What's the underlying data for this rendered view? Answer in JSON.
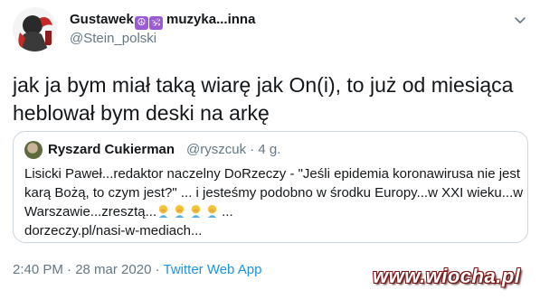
{
  "author": {
    "name": "Gustawek",
    "emoji_1": "☮",
    "emoji_2": "🕉",
    "name_suffix": " muzyka...inna",
    "handle": "@Stein_polski"
  },
  "tweet": {
    "line_1": "jak ja bym miał taką wiarę jak On(i), to już od miesiąca",
    "line_2": "heblował bym deski na arkę"
  },
  "quoted_tweet": {
    "author_name": "Ryszard Cukierman",
    "author_meta": "@ryszcuk · 4 g.",
    "line_1": "Lisicki Paweł...redaktor naczelny DoRzeczy - \"Jeśli epidemia koronawirusa nie jest",
    "line_2": "karą Bożą, to czym jest?\" ... i jesteśmy podobno w środku Europy...w XXI wieku...w",
    "line_3_text": "Warszawie...zresztą...",
    "line_3_trail": "...",
    "line_4": "dorzeczy.pl/nasi-w-mediach...",
    "emoji_name": "man-facepalming-emoji"
  },
  "footer": {
    "time_date": "2:40 PM · 28 mar 2020 · ",
    "source": "Twitter Web App"
  },
  "watermark": {
    "text": "www.wiocha.pl"
  },
  "colors": {
    "text": "#14171a",
    "secondary": "#657786",
    "link": "#1b95e0",
    "border": "#ccd6dd"
  }
}
